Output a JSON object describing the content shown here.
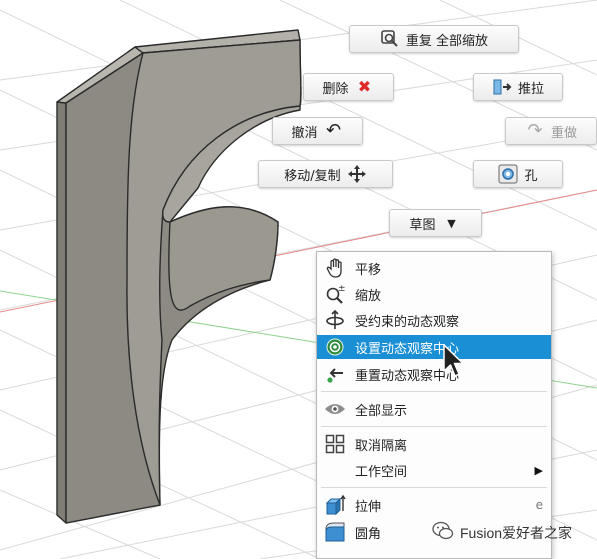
{
  "marking_menu": {
    "fit_all": {
      "label": "重复 全部缩放",
      "icon": "magnify-fit-icon"
    },
    "delete": {
      "label": "删除",
      "icon": "red-x-icon"
    },
    "press_pull": {
      "label": "推拉",
      "icon": "press-pull-icon"
    },
    "undo": {
      "label": "撤消",
      "icon": "undo-arrow-icon"
    },
    "redo": {
      "label": "重做",
      "icon": "redo-arrow-icon"
    },
    "move_copy": {
      "label": "移动/复制",
      "icon": "move-arrows-icon"
    },
    "hole": {
      "label": "孔",
      "icon": "hole-icon"
    },
    "sketch": {
      "label": "草图",
      "icon": "dropdown-triangle-icon"
    }
  },
  "context_menu": {
    "items": [
      {
        "label": "平移",
        "icon": "hand-pan-icon"
      },
      {
        "label": "缩放",
        "icon": "zoom-icon"
      },
      {
        "label": "受约束的动态观察",
        "icon": "constrained-orbit-icon"
      },
      {
        "label": "设置动态观察中心",
        "icon": "orbit-center-icon",
        "selected": true
      },
      {
        "label": "重置动态观察中心",
        "icon": "reset-orbit-center-icon"
      },
      {
        "label": "全部显示",
        "icon": "eye-icon"
      },
      {
        "label": "取消隔离",
        "icon": "unisolate-grid-icon"
      },
      {
        "label": "工作空间",
        "has_submenu": true
      },
      {
        "label": "拉伸",
        "icon": "extrude-icon",
        "shortcut": "e"
      },
      {
        "label": "圆角",
        "icon": "fillet-icon"
      }
    ]
  },
  "watermark": {
    "text": "Fusion爱好者之家",
    "icon": "wechat-icon"
  },
  "colors": {
    "selection": "#1b8fd6",
    "model_face": "#8c8a82",
    "grid": "#d7d7d7"
  }
}
